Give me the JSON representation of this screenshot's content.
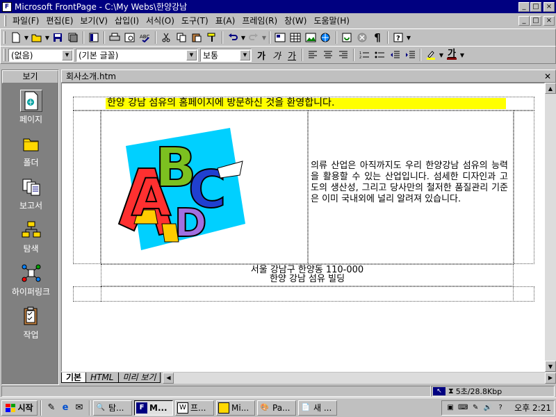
{
  "window": {
    "title": "Microsoft FrontPage - C:\\My Webs\\한양강남",
    "minimize": "_",
    "restore": "□",
    "close": "×"
  },
  "menu": [
    {
      "label": "파일(F)"
    },
    {
      "label": "편집(E)"
    },
    {
      "label": "보기(V)"
    },
    {
      "label": "삽입(I)"
    },
    {
      "label": "서식(O)"
    },
    {
      "label": "도구(T)"
    },
    {
      "label": "표(A)"
    },
    {
      "label": "프레임(R)"
    },
    {
      "label": "창(W)"
    },
    {
      "label": "도움말(H)"
    }
  ],
  "format_bar": {
    "style": "(없음)",
    "font": "(기본 글꼴)",
    "size": "보통",
    "bold": "가",
    "italic": "가",
    "underline": "가",
    "font_color": "가"
  },
  "views": {
    "header": "보기",
    "items": [
      {
        "label": "페이지",
        "icon": "page-icon"
      },
      {
        "label": "폴더",
        "icon": "folder-icon"
      },
      {
        "label": "보고서",
        "icon": "reports-icon"
      },
      {
        "label": "탐색",
        "icon": "navigation-icon"
      },
      {
        "label": "하이퍼링크",
        "icon": "hyperlinks-icon"
      },
      {
        "label": "작업",
        "icon": "tasks-icon"
      }
    ]
  },
  "document": {
    "tab_name": "회사소개.htm",
    "welcome": "한양 강남 섬유의 홈페이지에 방문하신 것을 환영합니다.",
    "paragraph": "의류 산업은 아직까지도 우리 한양강남 섬유의 능력을 활용할 수 있는 산업입니다. 섬세한 디자인과 고도의 생산성, 그리고 당사만의 철저한 품질관리 기준은 이미 국내외에 널리 알려져 있습니다.",
    "address_line1": "서울 강남구 한양동 110-000",
    "address_line2": "한양 강남 섬유 빌딩",
    "clipart_letters": [
      "A",
      "B",
      "C",
      "D"
    ]
  },
  "view_tabs": [
    "기본",
    "HTML",
    "미리 보기"
  ],
  "status": {
    "download_time": "5초/28.8Kbp"
  },
  "taskbar": {
    "start": "시작",
    "tasks": [
      {
        "label": "탐...",
        "active": false
      },
      {
        "label": "M...",
        "active": true
      },
      {
        "label": "프...",
        "active": false
      },
      {
        "label": "Mi...",
        "active": false
      },
      {
        "label": "Pa...",
        "active": false
      },
      {
        "label": "새 ...",
        "active": false
      }
    ],
    "clock": "오후 2:21"
  },
  "colors": {
    "title_bar": "#000080",
    "welcome_highlight": "#ffff00",
    "views_bar": "#808080"
  }
}
